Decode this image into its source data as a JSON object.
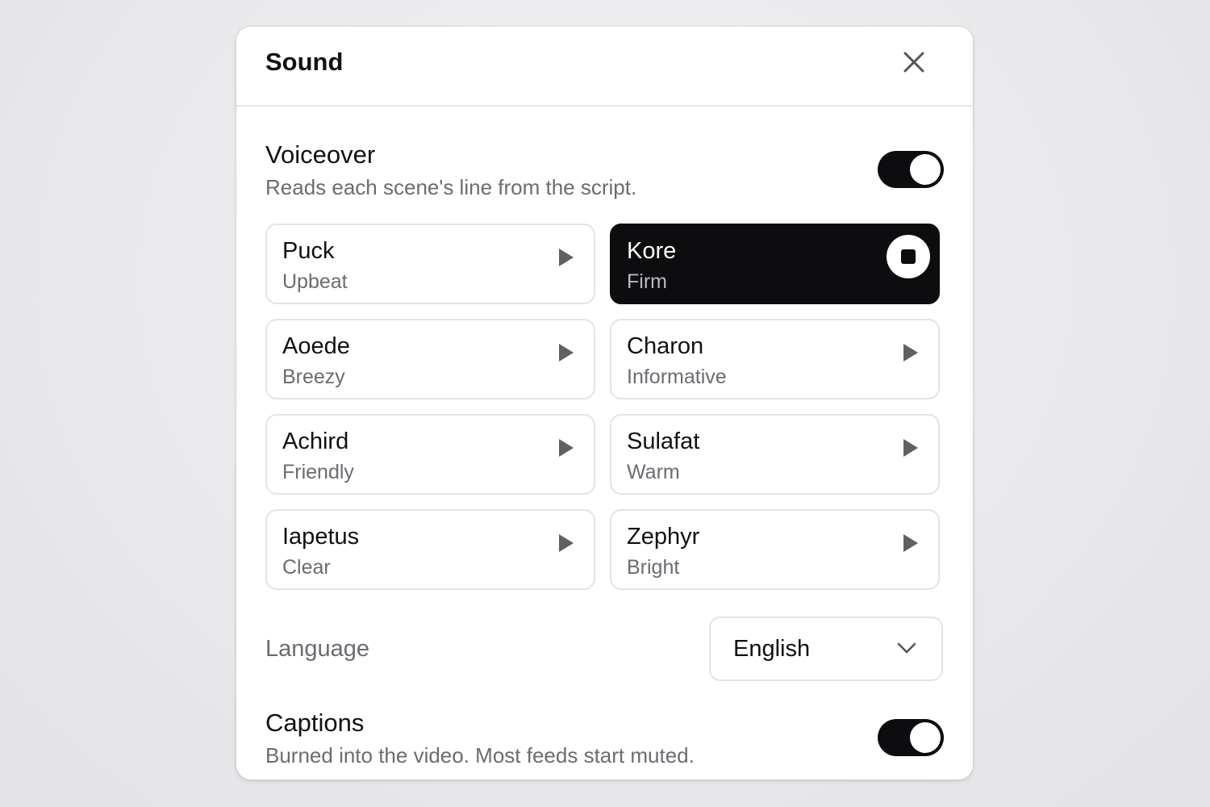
{
  "dialog": {
    "title": "Sound",
    "close_icon": "close-icon"
  },
  "voiceover": {
    "title": "Voiceover",
    "description": "Reads each scene's line from the script.",
    "enabled": true
  },
  "voices": [
    {
      "name": "Puck",
      "style": "Upbeat",
      "selected": false
    },
    {
      "name": "Kore",
      "style": "Firm",
      "selected": true
    },
    {
      "name": "Aoede",
      "style": "Breezy",
      "selected": false
    },
    {
      "name": "Charon",
      "style": "Informative",
      "selected": false
    },
    {
      "name": "Achird",
      "style": "Friendly",
      "selected": false
    },
    {
      "name": "Sulafat",
      "style": "Warm",
      "selected": false
    },
    {
      "name": "Iapetus",
      "style": "Clear",
      "selected": false
    },
    {
      "name": "Zephyr",
      "style": "Bright",
      "selected": false
    }
  ],
  "language": {
    "label": "Language",
    "selected": "English"
  },
  "captions": {
    "title": "Captions",
    "description": "Burned into the video. Most feeds start muted.",
    "enabled": true
  },
  "colors": {
    "accent": "#0d0d10",
    "muted_text": "#6b6b72",
    "border": "#e4e4e7",
    "icon_gray": "#5f5f66"
  }
}
